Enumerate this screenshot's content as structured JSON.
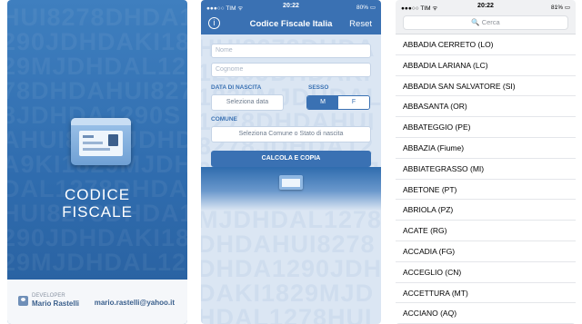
{
  "splash": {
    "watermark": "HUI8278DHDA1290JDHDAKI1829MJDHDAL1278DHDAHUI8278JDHDA1290SAHUI8278JDHDA9KI1829MJDHDAL1278DHDAHUI8278DHDA1290JDHDAKI1829MJDHDAL1278",
    "title_line1": "CODICE",
    "title_line2": "FISCALE",
    "developer_label": "DEVELOPER",
    "developer_name": "Mario Rastelli",
    "developer_email": "mario.rastelli@yahoo.it"
  },
  "status_a": {
    "carrier": "●●●○○ TIM ᯤ",
    "time": "20:22",
    "battery": "80% ▭"
  },
  "status_b": {
    "carrier": "●●●○○ TIM ᯤ",
    "time": "20:22",
    "battery": "81% ▭"
  },
  "form": {
    "watermark": "HUI8278DHDA1290JDHDAKI1829MJDHDAL1278DHDAHUI8278JDHDA1290SAHUI8278JDHDA9KI1829MJDHDAL1278DHDAHUI8278DHDA1290JDHDAKI1829MJDHDAL1278HUI8278DHDA1290JDHDAKI1829MJDHDAL1278",
    "info_icon": "i",
    "title": "Codice Fiscale Italia",
    "reset": "Reset",
    "name_placeholder": "Nome",
    "surname_placeholder": "Cognome",
    "birth_label": "DATA DI NASCITA",
    "sex_label": "SESSO",
    "date_button": "Seleziona data",
    "sex_m": "M",
    "sex_f": "F",
    "comune_label": "COMUNE",
    "comune_button": "Seleziona Comune o Stato di nascita",
    "calculate_button": "CALCOLA E COPIA"
  },
  "list": {
    "search_placeholder": "🔍 Cerca",
    "items": [
      "ABBADIA CERRETO (LO)",
      "ABBADIA LARIANA (LC)",
      "ABBADIA SAN SALVATORE (SI)",
      "ABBASANTA (OR)",
      "ABBATEGGIO (PE)",
      "ABBAZIA (Fiume)",
      "ABBIATEGRASSO (MI)",
      "ABETONE (PT)",
      "ABRIOLA (PZ)",
      "ACATE (RG)",
      "ACCADIA (FG)",
      "ACCEGLIO (CN)",
      "ACCETTURA (MT)",
      "ACCIANO (AQ)"
    ]
  }
}
